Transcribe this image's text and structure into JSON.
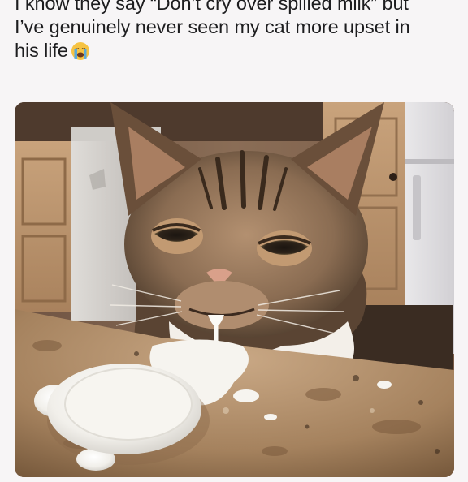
{
  "post": {
    "caption_lines": [
      "I know they say “Don’t cry over spilled milk” but",
      "I’ve genuinely never seen my cat more upset in",
      "his life"
    ],
    "caption_emoji": "loudly-crying-face-emoji"
  },
  "photo": {
    "subjects": [
      "cat-face",
      "milk-bowl",
      "spilled-milk",
      "granite-countertop",
      "kitchen-cabinets",
      "dishwasher",
      "refrigerator"
    ]
  },
  "colors": {
    "background": "#f7f5f6",
    "text": "#1d1d1f",
    "emoji_face": "#f6c343",
    "emoji_tear": "#4aa6e8"
  }
}
